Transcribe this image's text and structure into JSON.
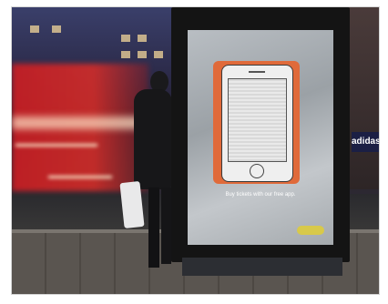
{
  "scene": {
    "kiosk_brand": "",
    "ad_tagline": "Buy tickets with our free app.",
    "fine_print": "",
    "store_sign": "adidas"
  },
  "colors": {
    "phone_orange": "#e06a3a",
    "bus_red": "#d62a2a",
    "screen_silver": "#b3b8bd"
  }
}
